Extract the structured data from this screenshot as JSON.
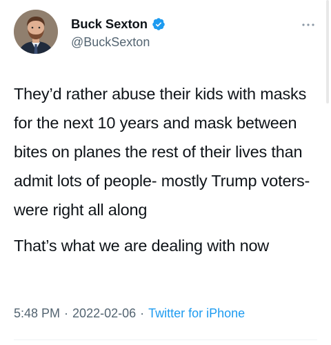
{
  "author": {
    "display_name": "Buck Sexton",
    "handle": "@BuckSexton",
    "verified": true,
    "avatar_icon": "profile-photo"
  },
  "tweet": {
    "paragraphs": [
      "They’d rather abuse their kids with masks for the next 10 years and mask between bites on planes the rest of their lives than admit lots of people- mostly Trump voters- were right all along",
      "That’s what we are dealing with now"
    ],
    "time": "5:48 PM",
    "date": "2022-02-06",
    "separator": "·",
    "source": "Twitter for iPhone"
  },
  "icons": {
    "verified": "verified-badge-icon",
    "more": "more-options-icon"
  },
  "colors": {
    "accent": "#1d9bf0",
    "text": "#0f1419",
    "secondary_text": "#536471"
  }
}
